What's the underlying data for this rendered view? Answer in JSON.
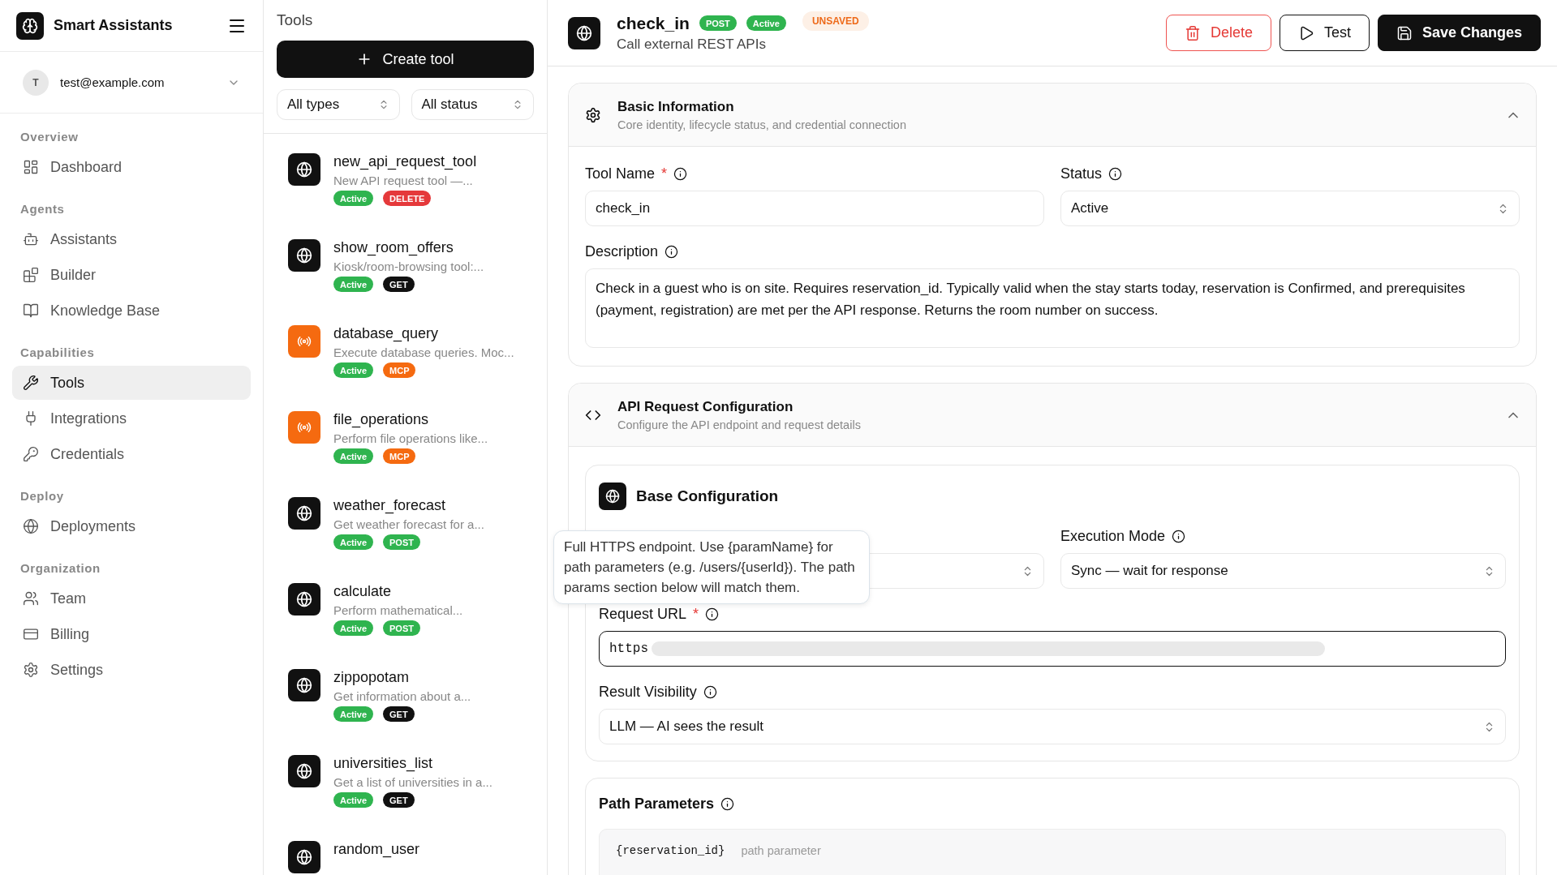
{
  "sidebar": {
    "brand": "Smart Assistants",
    "user": {
      "initial": "T",
      "email": "test@example.com"
    },
    "sections": [
      {
        "label": "Overview",
        "items": [
          {
            "label": "Dashboard",
            "selected": false
          }
        ]
      },
      {
        "label": "Agents",
        "items": [
          {
            "label": "Assistants",
            "selected": false
          },
          {
            "label": "Builder",
            "selected": false
          },
          {
            "label": "Knowledge Base",
            "selected": false
          }
        ]
      },
      {
        "label": "Capabilities",
        "items": [
          {
            "label": "Tools",
            "selected": true
          },
          {
            "label": "Integrations",
            "selected": false
          },
          {
            "label": "Credentials",
            "selected": false
          }
        ]
      },
      {
        "label": "Deploy",
        "items": [
          {
            "label": "Deployments",
            "selected": false
          }
        ]
      },
      {
        "label": "Organization",
        "items": [
          {
            "label": "Team",
            "selected": false
          },
          {
            "label": "Billing",
            "selected": false
          },
          {
            "label": "Settings",
            "selected": false
          }
        ]
      }
    ]
  },
  "tool_list": {
    "title": "Tools",
    "create_button": "Create tool",
    "filters": [
      {
        "value": "All types"
      },
      {
        "value": "All status"
      }
    ],
    "tools": [
      {
        "kind": "api",
        "name": "new_api_request_tool",
        "description": "New API request tool —...",
        "status": "Active",
        "type": {
          "label": "DELETE",
          "color": "#e5393b"
        }
      },
      {
        "kind": "api",
        "name": "show_room_offers",
        "description": "Kiosk/room-browsing tool:...",
        "status": "Active",
        "type": {
          "label": "GET",
          "color": "#111111"
        }
      },
      {
        "kind": "mcp",
        "name": "database_query",
        "description": "Execute database queries. Moc...",
        "status": "Active",
        "type": {
          "label": "MCP",
          "color": "#f56a10"
        }
      },
      {
        "kind": "mcp",
        "name": "file_operations",
        "description": "Perform file operations like...",
        "status": "Active",
        "type": {
          "label": "MCP",
          "color": "#f56a10"
        }
      },
      {
        "kind": "api",
        "name": "weather_forecast",
        "description": "Get weather forecast for a...",
        "status": "Active",
        "type": {
          "label": "POST",
          "color": "#2fb44f"
        }
      },
      {
        "kind": "api",
        "name": "calculate",
        "description": "Perform mathematical...",
        "status": "Active",
        "type": {
          "label": "POST",
          "color": "#2fb44f"
        }
      },
      {
        "kind": "api",
        "name": "zippopotam",
        "description": "Get information about a...",
        "status": "Active",
        "type": {
          "label": "GET",
          "color": "#111111"
        }
      },
      {
        "kind": "api",
        "name": "universities_list",
        "description": "Get a list of universities in a...",
        "status": "Active",
        "type": {
          "label": "GET",
          "color": "#111111"
        }
      },
      {
        "kind": "api",
        "name": "random_user"
      }
    ]
  },
  "header": {
    "title": "check_in",
    "badges": [
      {
        "label": "POST",
        "color": "#2fb44f"
      },
      {
        "label": "Active",
        "color": "#2fb44f"
      }
    ],
    "subtitle": "Call external REST APIs",
    "unsaved": "UNSAVED",
    "actions": [
      {
        "label": "Delete",
        "kind": "danger"
      },
      {
        "label": "Test",
        "kind": "outline"
      },
      {
        "label": "Save Changes",
        "kind": "primary"
      }
    ]
  },
  "basic_information": {
    "title": "Basic Information",
    "subtitle": "Core identity, lifecycle status, and credential connection",
    "expanded": true,
    "tool_name": {
      "label": "Tool Name",
      "required_mark": "*",
      "value": "check_in"
    },
    "status": {
      "label": "Status",
      "value": "Active"
    },
    "description": {
      "label": "Description",
      "value": "Check in a guest who is on site. Requires reservation_id. Typically valid when the stay starts today, reservation is Confirmed, and prerequisites (payment, registration) are met per the API response. Returns the room number on success."
    }
  },
  "api_request_configuration": {
    "title": "API Request Configuration",
    "subtitle": "Configure the API endpoint and request details",
    "expanded": true,
    "base_configuration": {
      "title": "Base Configuration",
      "execution_mode": {
        "label": "Execution Mode",
        "value": "Sync — wait for response"
      },
      "request_url": {
        "label": "Request URL",
        "required_mark": "*",
        "value": "https"
      },
      "result_visibility": {
        "label": "Result Visibility",
        "value": "LLM — AI sees the result"
      },
      "tooltip": "Full HTTPS endpoint. Use {paramName} for path parameters (e.g. /users/{userId}). The path params section below will match them."
    },
    "path_parameters": {
      "title": "Path Parameters",
      "params": [
        {
          "name": "{reservation_id}",
          "hint": "path parameter"
        }
      ]
    }
  }
}
